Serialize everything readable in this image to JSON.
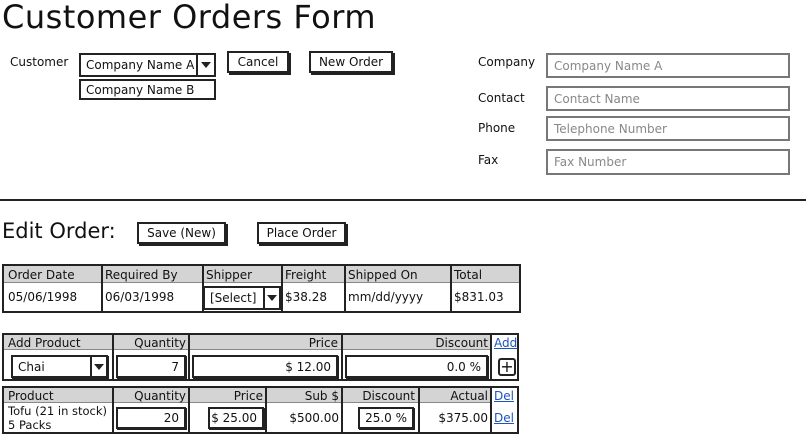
{
  "page": {
    "title": "Customer Orders Form"
  },
  "customer": {
    "label": "Customer",
    "selected": "Company Name A",
    "dropdown_option": "Company Name B",
    "cancel_label": "Cancel",
    "new_order_label": "New Order"
  },
  "details": {
    "company_label": "Company",
    "company_placeholder": "Company Name A",
    "contact_label": "Contact",
    "contact_placeholder": "Contact Name",
    "phone_label": "Phone",
    "phone_placeholder": "Telephone Number",
    "fax_label": "Fax",
    "fax_placeholder": "Fax Number"
  },
  "edit_order": {
    "title": "Edit Order:",
    "save_label": "Save (New)",
    "place_label": "Place Order"
  },
  "order_info": {
    "headers": [
      "Order Date",
      "Required By",
      "Shipper",
      "Freight",
      "Shipped On",
      "Total"
    ],
    "order_date": "05/06/1998",
    "required_by": "06/03/1998",
    "shipper": "[Select]",
    "freight": "$38.28",
    "shipped_on": "mm/dd/yyyy",
    "total": "$831.03"
  },
  "add_product": {
    "headers": [
      "Add Product",
      "Quantity",
      "Price",
      "Discount"
    ],
    "add_link": "Add",
    "product": "Chai",
    "quantity": "7",
    "price": "$ 12.00",
    "discount": "0.0 %",
    "plus_icon": "plus-box-icon"
  },
  "line_items": {
    "headers": [
      "Product",
      "Quantity",
      "Price",
      "Sub $",
      "Discount",
      "Actual"
    ],
    "del_header": "Del",
    "rows": [
      {
        "product_line1": "Tofu (21 in stock)",
        "product_line2": "5 Packs",
        "quantity": "20",
        "price": "$ 25.00",
        "sub": "$500.00",
        "discount": "25.0 %",
        "actual": "$375.00",
        "del": "Del"
      }
    ]
  }
}
